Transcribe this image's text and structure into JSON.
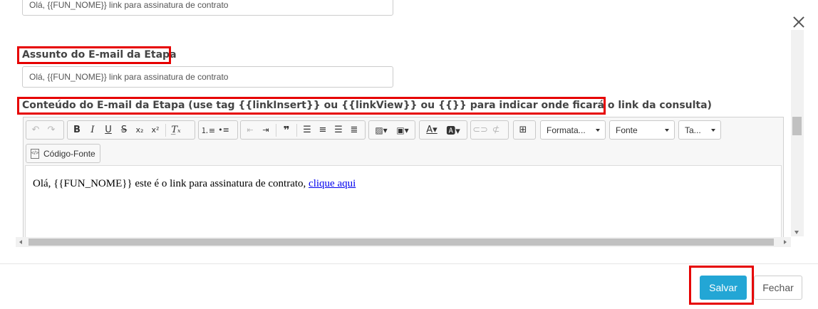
{
  "form": {
    "previous_value": "Olá, {{FUN_NOME}} link para assinatura de contrato",
    "subject_label": "Assunto do E-mail da Etapa",
    "subject_value": "Olá, {{FUN_NOME}} link para assinatura de contrato",
    "content_label": "Conteúdo do E-mail da Etapa (use tag {{linkInsert}} ou {{linkView}} ou {{}} para indicar onde ficará o link da consulta)"
  },
  "editor": {
    "format_combo": "Formata...",
    "font_combo": "Fonte",
    "size_combo": "Ta...",
    "source_button": "Código-Fonte",
    "body_text": "Olá, {{FUN_NOME}} este é o link para assinatura de contrato,",
    "body_link": "clique aqui",
    "toolbar_icons": [
      "undo-icon",
      "redo-icon",
      "bold-icon",
      "italic-icon",
      "underline-icon",
      "strikethrough-icon",
      "subscript-icon",
      "superscript-icon",
      "remove-format-icon",
      "numbered-list-icon",
      "bulleted-list-icon",
      "outdent-icon",
      "indent-icon",
      "blockquote-icon",
      "align-left-icon",
      "align-center-icon",
      "align-right-icon",
      "justify-icon",
      "image-icon",
      "media-icon",
      "text-color-icon",
      "background-color-icon",
      "link-icon",
      "unlink-icon",
      "table-icon"
    ]
  },
  "footer": {
    "save_label": "Salvar",
    "close_label": "Fechar"
  },
  "colors": {
    "primary": "#23a6d5",
    "highlight": "#e60000",
    "link": "#0000ee"
  }
}
